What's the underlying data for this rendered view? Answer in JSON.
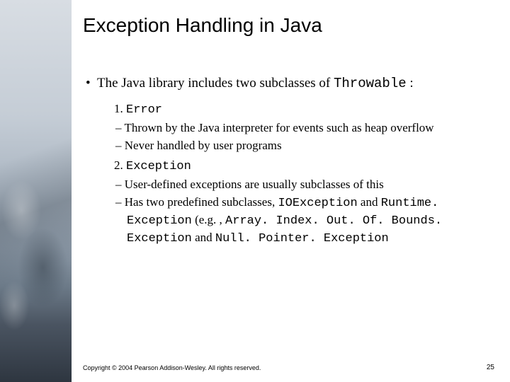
{
  "title": "Exception Handling in Java",
  "bullet_main_prefix": "The Java library includes two subclasses of ",
  "bullet_main_code": "Throwable",
  "bullet_main_suffix": " :",
  "item1_num": "1. ",
  "item1_code": "Error",
  "item1_dash1": "Thrown by the Java interpreter for events such as heap overflow",
  "item1_dash2": "Never handled by user programs",
  "item2_num": "2. ",
  "item2_code": "Exception",
  "item2_dash1": "User-defined exceptions are usually subclasses of this",
  "item2_dash2_a": "Has two predefined subclasses, ",
  "item2_dash2_code1": "IOException",
  "item2_dash2_b": " and ",
  "item2_dash2_code2": "Runtime. Exception",
  "item2_dash2_c": " (e.g. , ",
  "item2_dash2_code3": "Array. Index. Out. Of. Bounds. Exception",
  "item2_dash2_d": " and ",
  "item2_dash2_code4": "Null. Pointer. Exception",
  "copyright": "Copyright © 2004 Pearson Addison-Wesley. All rights reserved.",
  "page": "25"
}
